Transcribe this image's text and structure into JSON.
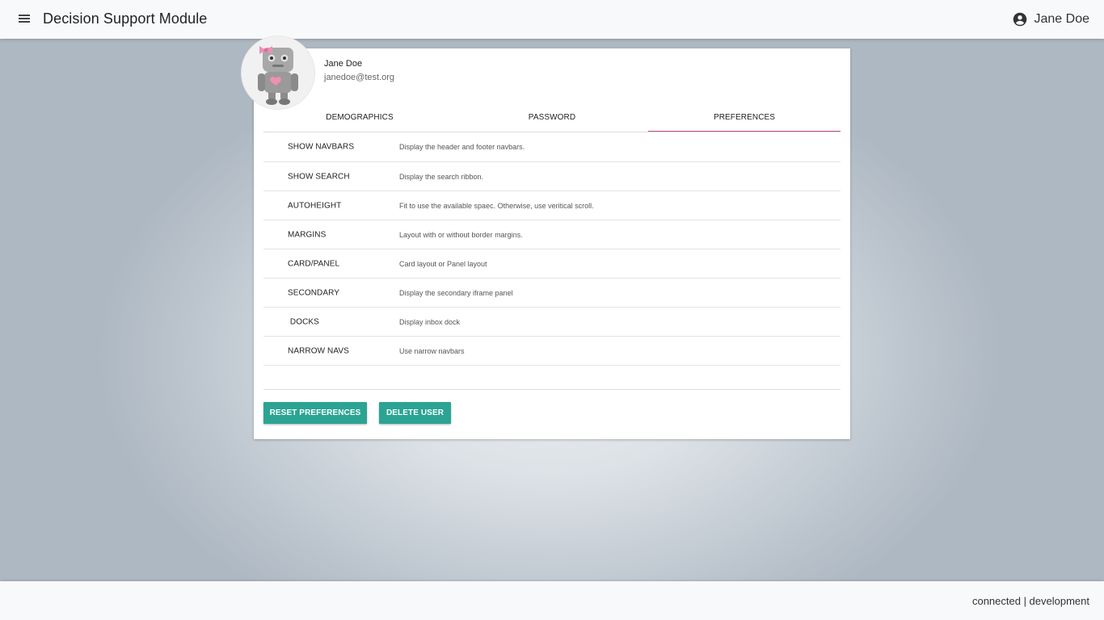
{
  "header": {
    "title": "Decision Support Module",
    "user_name": "Jane Doe"
  },
  "profile": {
    "name": "Jane Doe",
    "email": "janedoe@test.org"
  },
  "tabs": [
    {
      "label": "DEMOGRAPHICS",
      "active": false
    },
    {
      "label": "PASSWORD",
      "active": false
    },
    {
      "label": "PREFERENCES",
      "active": true
    }
  ],
  "preferences": [
    {
      "label": "SHOW NAVBARS",
      "description": "Display the header and footer navbars."
    },
    {
      "label": "SHOW SEARCH",
      "description": "Display the search ribbon."
    },
    {
      "label": "AUTOHEIGHT",
      "description": "Fit to use the available spaec. Otherwise, use veritical scroll."
    },
    {
      "label": "MARGINS",
      "description": "Layout with or without border margins."
    },
    {
      "label": "CARD/PANEL",
      "description": "Card layout or Panel layout"
    },
    {
      "label": "SECONDARY",
      "description": "Display the secondary iframe panel"
    },
    {
      "label": " DOCKS",
      "description": "Display inbox dock"
    },
    {
      "label": "NARROW NAVS",
      "description": "Use narrow navbars"
    }
  ],
  "actions": {
    "reset_label": "RESET PREFERENCES",
    "delete_label": "DELETE USER"
  },
  "footer": {
    "status": "connected | development"
  },
  "icons": {
    "menu": "menu-icon",
    "user": "account-circle-icon",
    "avatar": "robot-plush-avatar"
  },
  "colors": {
    "accent_button": "#2ba494",
    "active_tab_underline": "#c24f8d",
    "header_bg": "#f8f9fa"
  }
}
